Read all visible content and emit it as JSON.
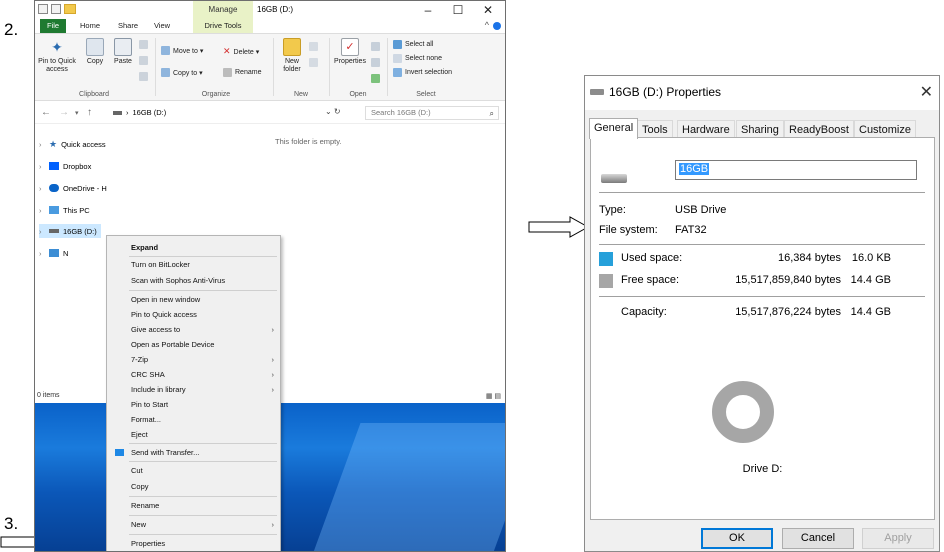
{
  "steps": {
    "two": "2.",
    "three": "3."
  },
  "explorer": {
    "title": "16GB (D:)",
    "manage_tab": "Manage",
    "window_controls": {
      "minimize": "–",
      "maximize": "☐",
      "close": "✕"
    },
    "collapse_icon": "^",
    "tabs": [
      "File",
      "Home",
      "Share",
      "View",
      "Drive Tools"
    ],
    "ribbon": {
      "pin_quick_access": "Pin to Quick access",
      "copy": "Copy",
      "paste": "Paste",
      "move_to": "Move to ▾",
      "delete": "Delete ▾",
      "copy_to": "Copy to ▾",
      "rename": "Rename",
      "new_folder": "New folder",
      "properties": "Properties",
      "select_all": "Select all",
      "select_none": "Select none",
      "invert_selection": "Invert selection",
      "groups": [
        "Clipboard",
        "Organize",
        "New",
        "Open",
        "Select"
      ]
    },
    "nav_arrows": {
      "back": "←",
      "forward": "→",
      "recent": "▾",
      "up": "↑"
    },
    "address": "16GB (D:)",
    "address_sep": "›",
    "refresh_label": "⌄ ↻",
    "search_placeholder": "Search 16GB (D:)",
    "search_icon": "⌕",
    "nav_items": [
      "Quick access",
      "Dropbox",
      "OneDrive - H",
      "This PC",
      "16GB (D:)",
      "N"
    ],
    "empty_message": "This folder is empty.",
    "status": "0 items",
    "view_icons": "▦ ▤"
  },
  "context_menu": {
    "items": [
      {
        "label": "Expand",
        "bold": true
      },
      {
        "label": "Turn on BitLocker"
      },
      {
        "label": "Scan with Sophos Anti-Virus"
      },
      {
        "label": "Open in new window"
      },
      {
        "label": "Pin to Quick access"
      },
      {
        "label": "Give access to",
        "sub": true
      },
      {
        "label": "Open as Portable Device"
      },
      {
        "label": "7-Zip",
        "sub": true
      },
      {
        "label": "CRC SHA",
        "sub": true
      },
      {
        "label": "Include in library",
        "sub": true
      },
      {
        "label": "Pin to Start"
      },
      {
        "label": "Format..."
      },
      {
        "label": "Eject"
      },
      {
        "label": "Send with Transfer...",
        "icon": "dropbox-icon"
      },
      {
        "label": "Cut"
      },
      {
        "label": "Copy"
      },
      {
        "label": "Rename"
      },
      {
        "label": "New",
        "sub": true
      },
      {
        "label": "Properties"
      }
    ],
    "submenu_glyph": "›"
  },
  "properties": {
    "title": "16GB (D:) Properties",
    "close_glyph": "✕",
    "tabs": [
      "General",
      "Tools",
      "Hardware",
      "Sharing",
      "ReadyBoost",
      "Customize"
    ],
    "drive_name": "16GB",
    "type_label": "Type:",
    "type_value": "USB Drive",
    "fs_label": "File system:",
    "fs_value": "FAT32",
    "used_label": "Used space:",
    "used_bytes": "16,384 bytes",
    "used_size": "16.0 KB",
    "free_label": "Free space:",
    "free_bytes": "15,517,859,840 bytes",
    "free_size": "14.4 GB",
    "capacity_label": "Capacity:",
    "capacity_bytes": "15,517,876,224 bytes",
    "capacity_size": "14.4 GB",
    "drive_letter": "Drive D:",
    "used_fraction": 1e-06,
    "buttons": {
      "ok": "OK",
      "cancel": "Cancel",
      "apply": "Apply"
    },
    "colors": {
      "used": "#26a0da",
      "free": "#a6a6a6"
    }
  }
}
